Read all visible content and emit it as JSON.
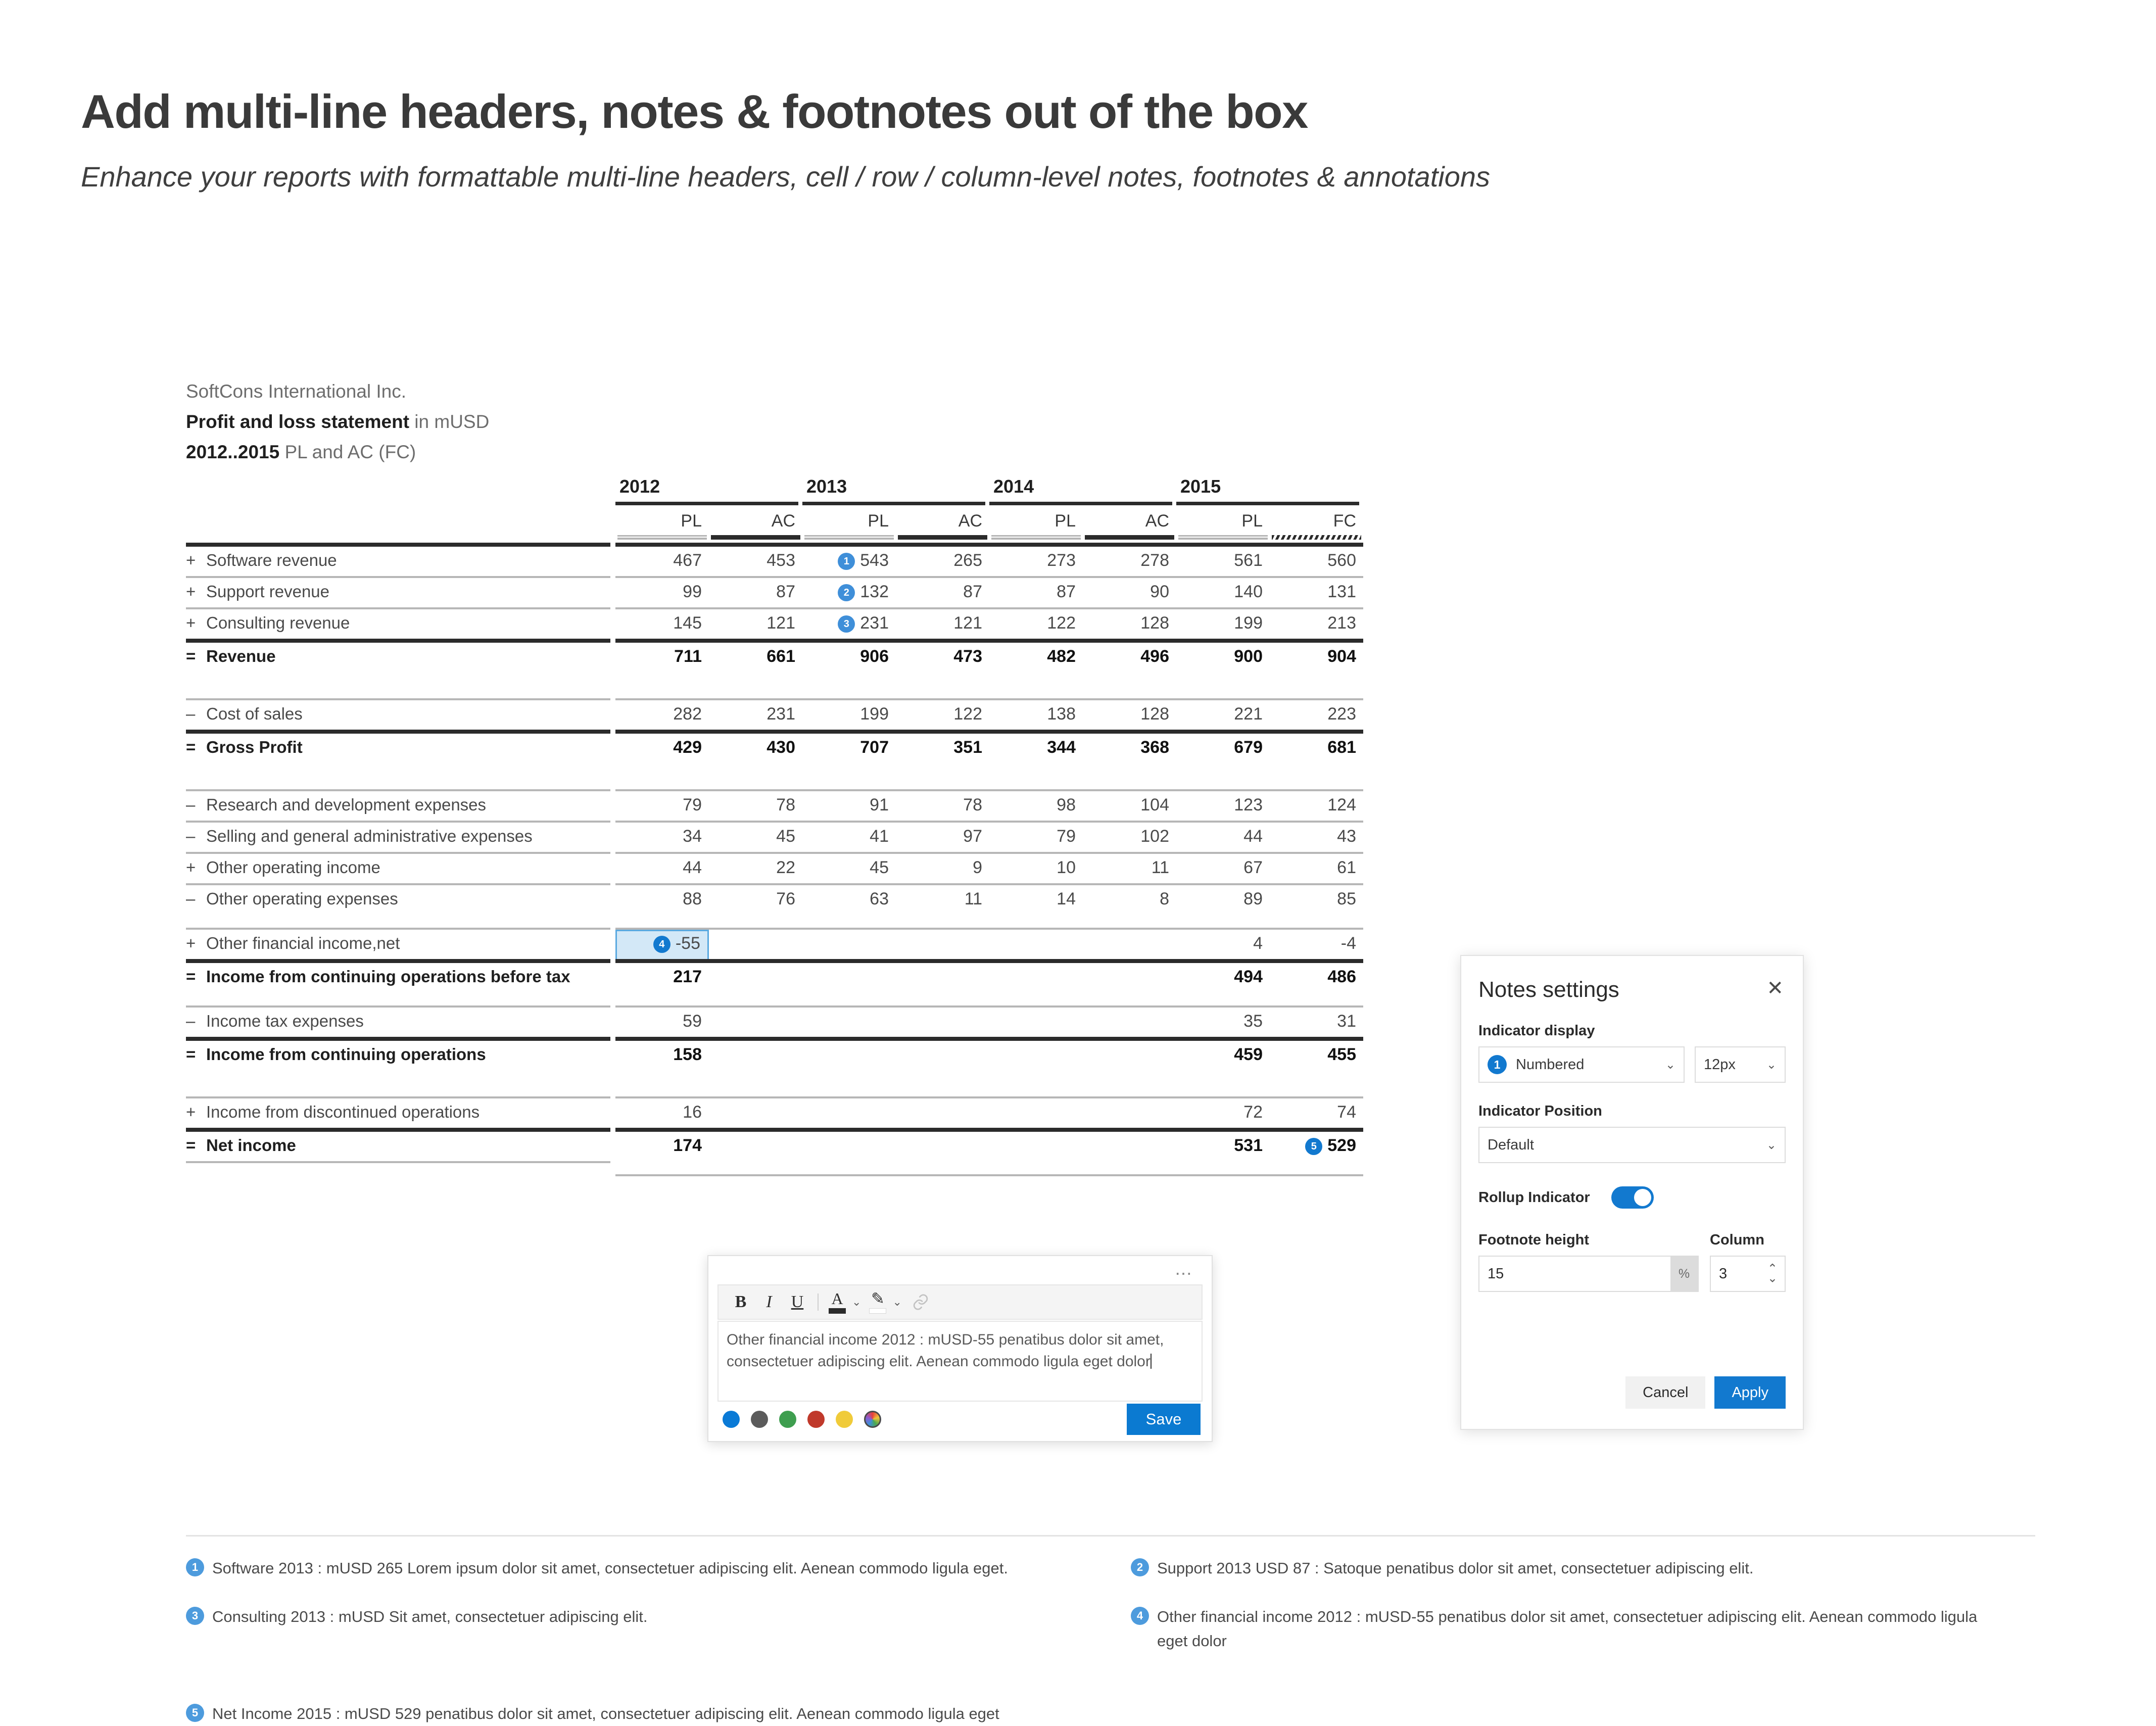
{
  "slide": {
    "title": "Add multi-line headers, notes & footnotes out of the box",
    "subtitle": "Enhance your reports with formattable multi-line headers, cell / row / column-level notes, footnotes & annotations"
  },
  "report": {
    "company": "SoftCons International Inc.",
    "statement_bold": "Profit and loss statement",
    "statement_rest": " in mUSD",
    "period_bold": "2012..2015",
    "period_rest": " PL and AC (FC)",
    "year_groups": [
      "2012",
      "2013",
      "2014",
      "2015"
    ],
    "scenario_headers": [
      "PL",
      "AC",
      "PL",
      "AC",
      "PL",
      "AC",
      "PL",
      "FC"
    ],
    "scenario_styles": [
      "pl",
      "ac",
      "pl",
      "ac",
      "pl",
      "ac",
      "pl",
      "fc"
    ]
  },
  "chart_data": {
    "type": "table",
    "title": "Profit and loss statement in mUSD",
    "subtitle": "2012..2015 PL and AC (FC)",
    "columns": [
      "2012 PL",
      "2012 AC",
      "2013 PL",
      "2013 AC",
      "2014 PL",
      "2014 AC",
      "2015 PL",
      "2015 FC"
    ],
    "rows": [
      {
        "sign": "+",
        "label": "Software revenue",
        "bold": false,
        "values": [
          "467",
          "453",
          "543",
          "265",
          "273",
          "278",
          "561",
          "560"
        ],
        "note_index": 2,
        "note_number": "1"
      },
      {
        "sign": "+",
        "label": "Support revenue",
        "bold": false,
        "values": [
          "99",
          "87",
          "132",
          "87",
          "87",
          "90",
          "140",
          "131"
        ],
        "note_index": 2,
        "note_number": "2"
      },
      {
        "sign": "+",
        "label": "Consulting revenue",
        "bold": false,
        "values": [
          "145",
          "121",
          "231",
          "121",
          "122",
          "128",
          "199",
          "213"
        ],
        "note_index": 2,
        "note_number": "3"
      },
      {
        "sign": "=",
        "label": "Revenue",
        "bold": true,
        "values": [
          "711",
          "661",
          "906",
          "473",
          "482",
          "496",
          "900",
          "904"
        ]
      },
      {
        "sign": "–",
        "label": "Cost of sales",
        "bold": false,
        "values": [
          "282",
          "231",
          "199",
          "122",
          "138",
          "128",
          "221",
          "223"
        ]
      },
      {
        "sign": "=",
        "label": "Gross Profit",
        "bold": true,
        "values": [
          "429",
          "430",
          "707",
          "351",
          "344",
          "368",
          "679",
          "681"
        ]
      },
      {
        "sign": "–",
        "label": "Research and development expenses",
        "bold": false,
        "values": [
          "79",
          "78",
          "91",
          "78",
          "98",
          "104",
          "123",
          "124"
        ]
      },
      {
        "sign": "–",
        "label": "Selling and general administrative expenses",
        "bold": false,
        "values": [
          "34",
          "45",
          "41",
          "97",
          "79",
          "102",
          "44",
          "43"
        ]
      },
      {
        "sign": "+",
        "label": "Other operating income",
        "bold": false,
        "values": [
          "44",
          "22",
          "45",
          "9",
          "10",
          "11",
          "67",
          "61"
        ]
      },
      {
        "sign": "–",
        "label": "Other operating expenses",
        "bold": false,
        "values": [
          "88",
          "76",
          "63",
          "11",
          "14",
          "8",
          "89",
          "85"
        ]
      },
      {
        "sign": "+",
        "label": "Other financial income,net",
        "bold": false,
        "values": [
          "-55",
          "",
          "",
          "",
          "",
          "",
          "4",
          "-4"
        ],
        "selected_index": 0,
        "note_index": 0,
        "note_number": "4"
      },
      {
        "sign": "=",
        "label": "Income from continuing operations before tax",
        "bold": true,
        "values": [
          "217",
          "",
          "",
          "",
          "",
          "",
          "494",
          "486"
        ]
      },
      {
        "sign": "–",
        "label": "Income tax expenses",
        "bold": false,
        "values": [
          "59",
          "",
          "",
          "",
          "",
          "",
          "35",
          "31"
        ]
      },
      {
        "sign": "=",
        "label": "Income from continuing operations",
        "bold": true,
        "values": [
          "158",
          "",
          "",
          "",
          "",
          "",
          "459",
          "455"
        ]
      },
      {
        "sign": "+",
        "label": "Income from discontinued operations",
        "bold": false,
        "values": [
          "16",
          "",
          "",
          "",
          "",
          "",
          "72",
          "74"
        ]
      },
      {
        "sign": "=",
        "label": "Net income",
        "bold": true,
        "values": [
          "174",
          "",
          "",
          "",
          "",
          "",
          "531",
          "529"
        ],
        "note_index": 7,
        "note_number": "5"
      }
    ]
  },
  "footnotes": [
    {
      "number": "1",
      "text": "Software 2013 : mUSD 265 Lorem ipsum dolor sit amet, consectetuer adipiscing elit. Aenean commodo ligula eget."
    },
    {
      "number": "2",
      "text": "Support 2013 USD 87 : Satoque penatibus dolor sit amet, consectetuer adipiscing elit."
    },
    {
      "number": "3",
      "text": "Consulting 2013 : mUSD Sit amet, consectetuer adipiscing elit."
    },
    {
      "number": "4",
      "text": "Other financial income 2012 : mUSD-55 penatibus dolor sit amet, consectetuer adipiscing elit. Aenean commodo ligula eget dolor"
    },
    {
      "number": "5",
      "text": "Net Income 2015 : mUSD 529 penatibus dolor sit amet, consectetuer adipiscing elit. Aenean commodo ligula eget"
    }
  ],
  "editor": {
    "kebab": "⋯",
    "bold_label": "B",
    "italic_label": "I",
    "underline_label": "U",
    "font_color_glyph": "A",
    "highlight_glyph": "✎",
    "link_glyph": "🔗",
    "chevron": "⌄",
    "note_text": "Other financial income 2012 : mUSD-55 penatibus dolor sit amet, consectetuer adipiscing elit. Aenean commodo ligula eget dolor",
    "save_label": "Save",
    "swatches": [
      "#0a7ad6",
      "#5b5b5b",
      "#3e9e4f",
      "#c0392b",
      "#f0cb3a"
    ],
    "custom_color_label": "custom"
  },
  "panel": {
    "title": "Notes settings",
    "close_glyph": "✕",
    "indicator_display_label": "Indicator display",
    "indicator_display_value": "Numbered",
    "indicator_display_badge": "1",
    "indicator_size_value": "12px",
    "indicator_position_label": "Indicator Position",
    "indicator_position_value": "Default",
    "rollup_label": "Rollup Indicator",
    "rollup_on": true,
    "footnote_height_label": "Footnote height",
    "footnote_height_value": "15",
    "footnote_height_suffix": "%",
    "column_label": "Column",
    "column_value": "3",
    "cancel_label": "Cancel",
    "apply_label": "Apply",
    "chevron": "⌄",
    "spin_up": "⌃",
    "spin_down": "⌄"
  }
}
